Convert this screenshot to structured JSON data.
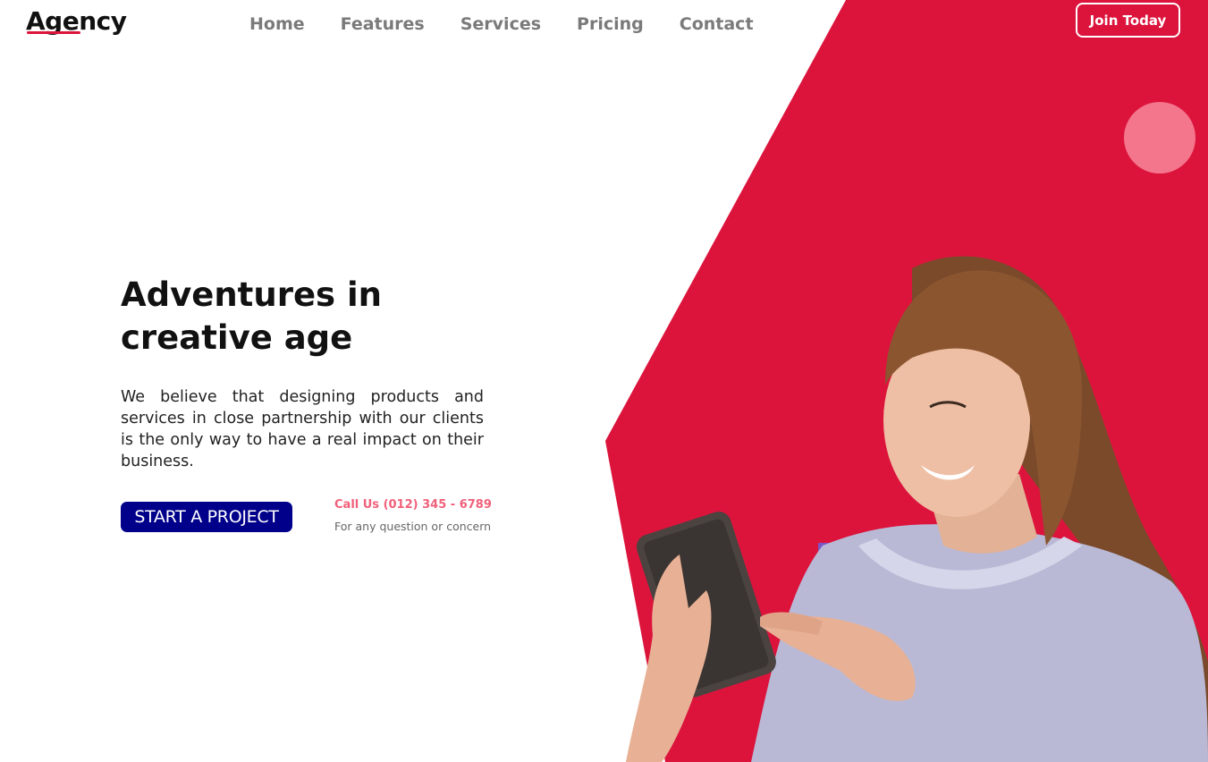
{
  "header": {
    "logo": "Agency",
    "nav": [
      "Home",
      "Features",
      "Services",
      "Pricing",
      "Contact"
    ],
    "join_label": "Join Today"
  },
  "hero": {
    "title_line1": "Adventures in",
    "title_line2": "creative age",
    "description": "We believe that designing products and services in close partnership with our clients is the only way to have a real impact on their business.",
    "cta_label": "START A PROJECT",
    "call_label": "Call Us (012) 345 - 6789",
    "call_sub": "For any question or concern"
  },
  "colors": {
    "brand_red": "#dc143c",
    "cta_blue": "#00008b",
    "accent_pink": "#f4768c",
    "accent_purple": "#7b55c7"
  },
  "icons": {
    "hero_person": "woman-with-tablet-illustration"
  }
}
